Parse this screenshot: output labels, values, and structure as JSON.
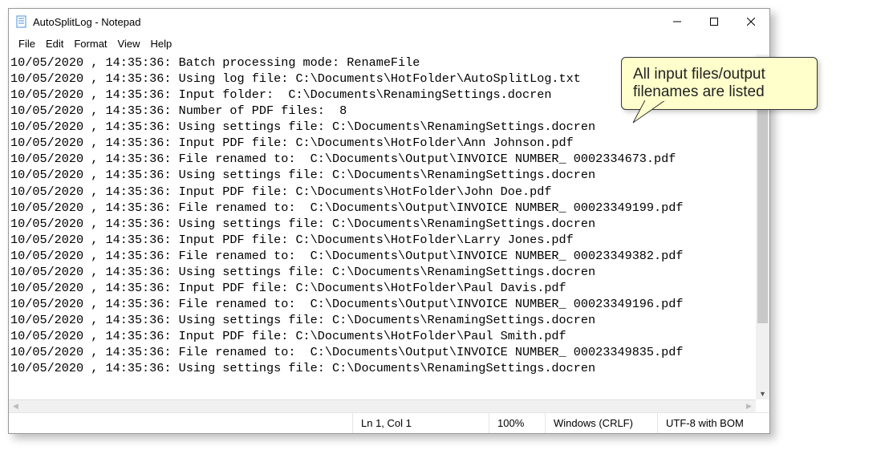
{
  "window": {
    "title": "AutoSplitLog - Notepad"
  },
  "menu": {
    "file": "File",
    "edit": "Edit",
    "format": "Format",
    "view": "View",
    "help": "Help"
  },
  "log_lines": [
    "10/05/2020 , 14:35:36: Batch processing mode: RenameFile",
    "10/05/2020 , 14:35:36: Using log file: C:\\Documents\\HotFolder\\AutoSplitLog.txt",
    "10/05/2020 , 14:35:36: Input folder:  C:\\Documents\\RenamingSettings.docren",
    "10/05/2020 , 14:35:36: Number of PDF files:  8",
    "10/05/2020 , 14:35:36: Using settings file: C:\\Documents\\RenamingSettings.docren",
    "10/05/2020 , 14:35:36: Input PDF file: C:\\Documents\\HotFolder\\Ann Johnson.pdf",
    "10/05/2020 , 14:35:36: File renamed to:  C:\\Documents\\Output\\INVOICE NUMBER_ 0002334673.pdf",
    "10/05/2020 , 14:35:36: Using settings file: C:\\Documents\\RenamingSettings.docren",
    "10/05/2020 , 14:35:36: Input PDF file: C:\\Documents\\HotFolder\\John Doe.pdf",
    "10/05/2020 , 14:35:36: File renamed to:  C:\\Documents\\Output\\INVOICE NUMBER_ 00023349199.pdf",
    "10/05/2020 , 14:35:36: Using settings file: C:\\Documents\\RenamingSettings.docren",
    "10/05/2020 , 14:35:36: Input PDF file: C:\\Documents\\HotFolder\\Larry Jones.pdf",
    "10/05/2020 , 14:35:36: File renamed to:  C:\\Documents\\Output\\INVOICE NUMBER_ 00023349382.pdf",
    "10/05/2020 , 14:35:36: Using settings file: C:\\Documents\\RenamingSettings.docren",
    "10/05/2020 , 14:35:36: Input PDF file: C:\\Documents\\HotFolder\\Paul Davis.pdf",
    "10/05/2020 , 14:35:36: File renamed to:  C:\\Documents\\Output\\INVOICE NUMBER_ 00023349196.pdf",
    "10/05/2020 , 14:35:36: Using settings file: C:\\Documents\\RenamingSettings.docren",
    "10/05/2020 , 14:35:36: Input PDF file: C:\\Documents\\HotFolder\\Paul Smith.pdf",
    "10/05/2020 , 14:35:36: File renamed to:  C:\\Documents\\Output\\INVOICE NUMBER_ 00023349835.pdf",
    "10/05/2020 , 14:35:36: Using settings file: C:\\Documents\\RenamingSettings.docren"
  ],
  "status": {
    "lncol": "Ln 1, Col 1",
    "zoom": "100%",
    "eol": "Windows (CRLF)",
    "encoding": "UTF-8 with BOM"
  },
  "callout": {
    "line1": "All input files/output",
    "line2": "filenames are listed"
  }
}
